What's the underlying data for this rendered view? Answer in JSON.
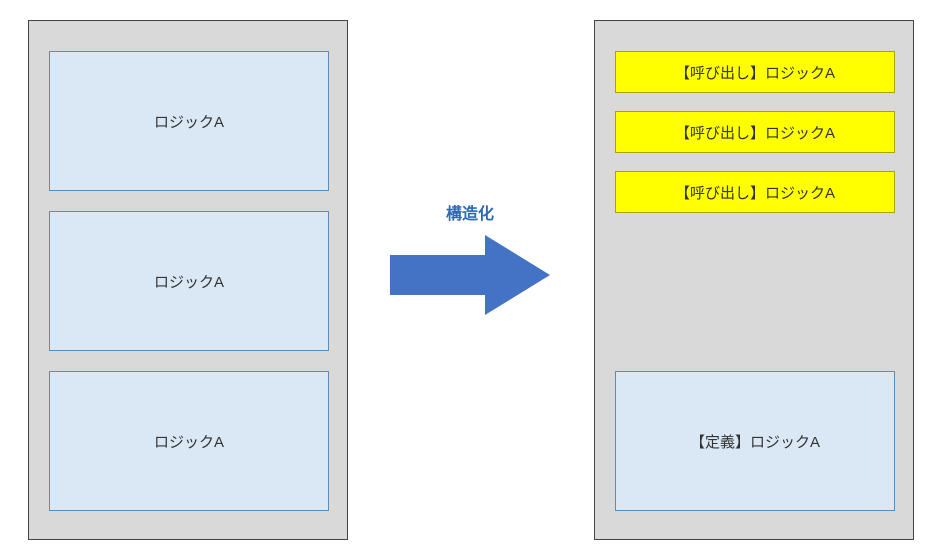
{
  "left": {
    "boxes": [
      {
        "label": "ロジックA"
      },
      {
        "label": "ロジックA"
      },
      {
        "label": "ロジックA"
      }
    ]
  },
  "arrow": {
    "label": "構造化",
    "color": "#4472c4"
  },
  "right": {
    "calls": [
      {
        "label": "【呼び出し】ロジックA"
      },
      {
        "label": "【呼び出し】ロジックA"
      },
      {
        "label": "【呼び出し】ロジックA"
      }
    ],
    "definition": {
      "label": "【定義】ロジックA"
    }
  }
}
